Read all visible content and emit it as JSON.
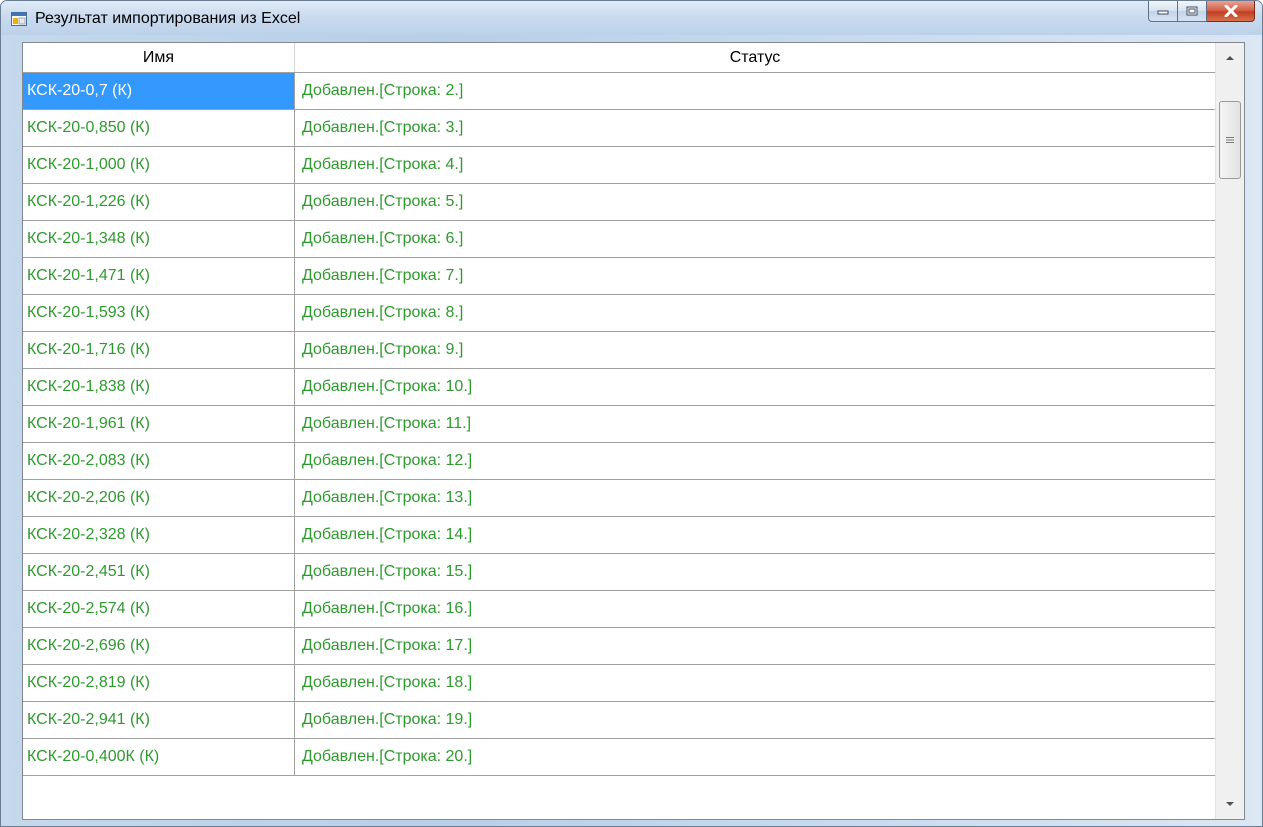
{
  "window": {
    "title": "Результат импортирования из Excel",
    "icon": "app-window-icon",
    "buttons": [
      "minimize-icon",
      "maximize-icon",
      "close-icon"
    ]
  },
  "table": {
    "headers": {
      "name": "Имя",
      "status": "Статус"
    },
    "rows": [
      {
        "name": "КСК-20-0,7 (К)",
        "status": "Добавлен.[Строка: 2.]"
      },
      {
        "name": "КСК-20-0,850 (К)",
        "status": "Добавлен.[Строка: 3.]"
      },
      {
        "name": "КСК-20-1,000 (К)",
        "status": "Добавлен.[Строка: 4.]"
      },
      {
        "name": "КСК-20-1,226 (К)",
        "status": "Добавлен.[Строка: 5.]"
      },
      {
        "name": "КСК-20-1,348 (К)",
        "status": "Добавлен.[Строка: 6.]"
      },
      {
        "name": "КСК-20-1,471 (К)",
        "status": "Добавлен.[Строка: 7.]"
      },
      {
        "name": "КСК-20-1,593 (К)",
        "status": "Добавлен.[Строка: 8.]"
      },
      {
        "name": "КСК-20-1,716 (К)",
        "status": "Добавлен.[Строка: 9.]"
      },
      {
        "name": "КСК-20-1,838 (К)",
        "status": "Добавлен.[Строка: 10.]"
      },
      {
        "name": "КСК-20-1,961 (К)",
        "status": "Добавлен.[Строка: 11.]"
      },
      {
        "name": "КСК-20-2,083 (К)",
        "status": "Добавлен.[Строка: 12.]"
      },
      {
        "name": "КСК-20-2,206 (К)",
        "status": "Добавлен.[Строка: 13.]"
      },
      {
        "name": "КСК-20-2,328 (К)",
        "status": "Добавлен.[Строка: 14.]"
      },
      {
        "name": "КСК-20-2,451 (К)",
        "status": "Добавлен.[Строка: 15.]"
      },
      {
        "name": "КСК-20-2,574 (К)",
        "status": "Добавлен.[Строка: 16.]"
      },
      {
        "name": "КСК-20-2,696 (К)",
        "status": "Добавлен.[Строка: 17.]"
      },
      {
        "name": "КСК-20-2,819 (К)",
        "status": "Добавлен.[Строка: 18.]"
      },
      {
        "name": "КСК-20-2,941 (К)",
        "status": "Добавлен.[Строка: 19.]"
      },
      {
        "name": "КСК-20-0,400К (К)",
        "status": "Добавлен.[Строка: 20.]"
      }
    ],
    "selected_row": 0,
    "colors": {
      "status_text": "#2e9a2e",
      "selection": "#3399ff"
    }
  },
  "scrollbar": {
    "up_icon": "arrow-up-icon",
    "down_icon": "arrow-down-icon",
    "thumb_icon": "grip-icon"
  }
}
